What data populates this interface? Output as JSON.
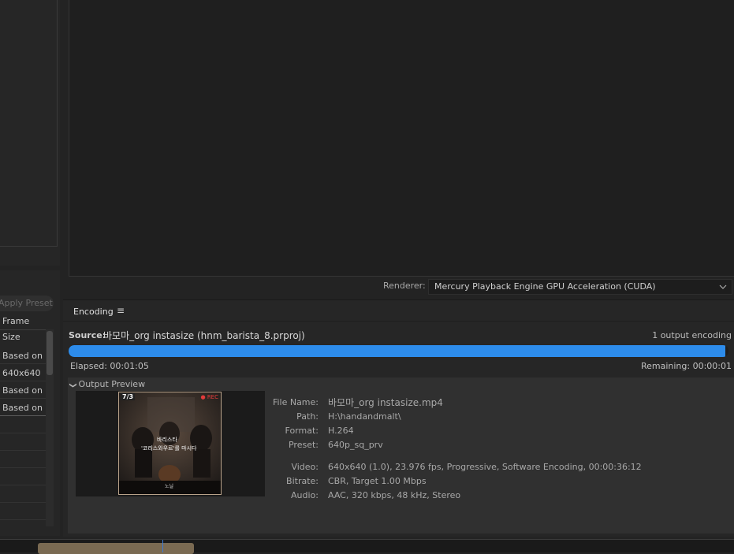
{
  "left_panel": {
    "apply_preset_label": "Apply Preset",
    "frame_size_header": "Frame Size",
    "rows": [
      "Based on s",
      "640x640",
      "Based on s",
      "Based on s"
    ]
  },
  "preview": {
    "renderer_label": "Renderer:",
    "renderer_value": "Mercury Playback Engine GPU Acceleration (CUDA)"
  },
  "encoding": {
    "tab_label": "Encoding",
    "menu_icon": "≡",
    "source_label": "Source:",
    "source_value": "바모마_org instasize (hnm_barista_8.prproj)",
    "output_count": "1 output encoding",
    "progress": 0.995,
    "progress_color": "#2d8ceb",
    "elapsed": "Elapsed: 00:01:05",
    "remaining": "Remaining: 00:00:01",
    "output_preview_label": "Output Preview",
    "thumbnail": {
      "badge_left": "7/3",
      "badge_right": "● REC",
      "line1": "바리스타",
      "line2": "'코리스와우르'를 마시다",
      "footer": "노닐"
    },
    "meta": [
      {
        "label": "File Name:",
        "value": "바모마_org instasize.mp4"
      },
      {
        "label": "Path:",
        "value": "H:\\handandmalt\\"
      },
      {
        "label": "Format:",
        "value": "H.264"
      },
      {
        "label": "Preset:",
        "value": "640p_sq_prv"
      },
      {
        "label": "Video:",
        "value": "640x640 (1.0), 23.976 fps, Progressive, Software Encoding, 00:00:36:12"
      },
      {
        "label": "Bitrate:",
        "value": "CBR, Target 1.00 Mbps"
      },
      {
        "label": "Audio:",
        "value": "AAC, 320 kbps, 48 kHz, Stereo"
      }
    ]
  }
}
